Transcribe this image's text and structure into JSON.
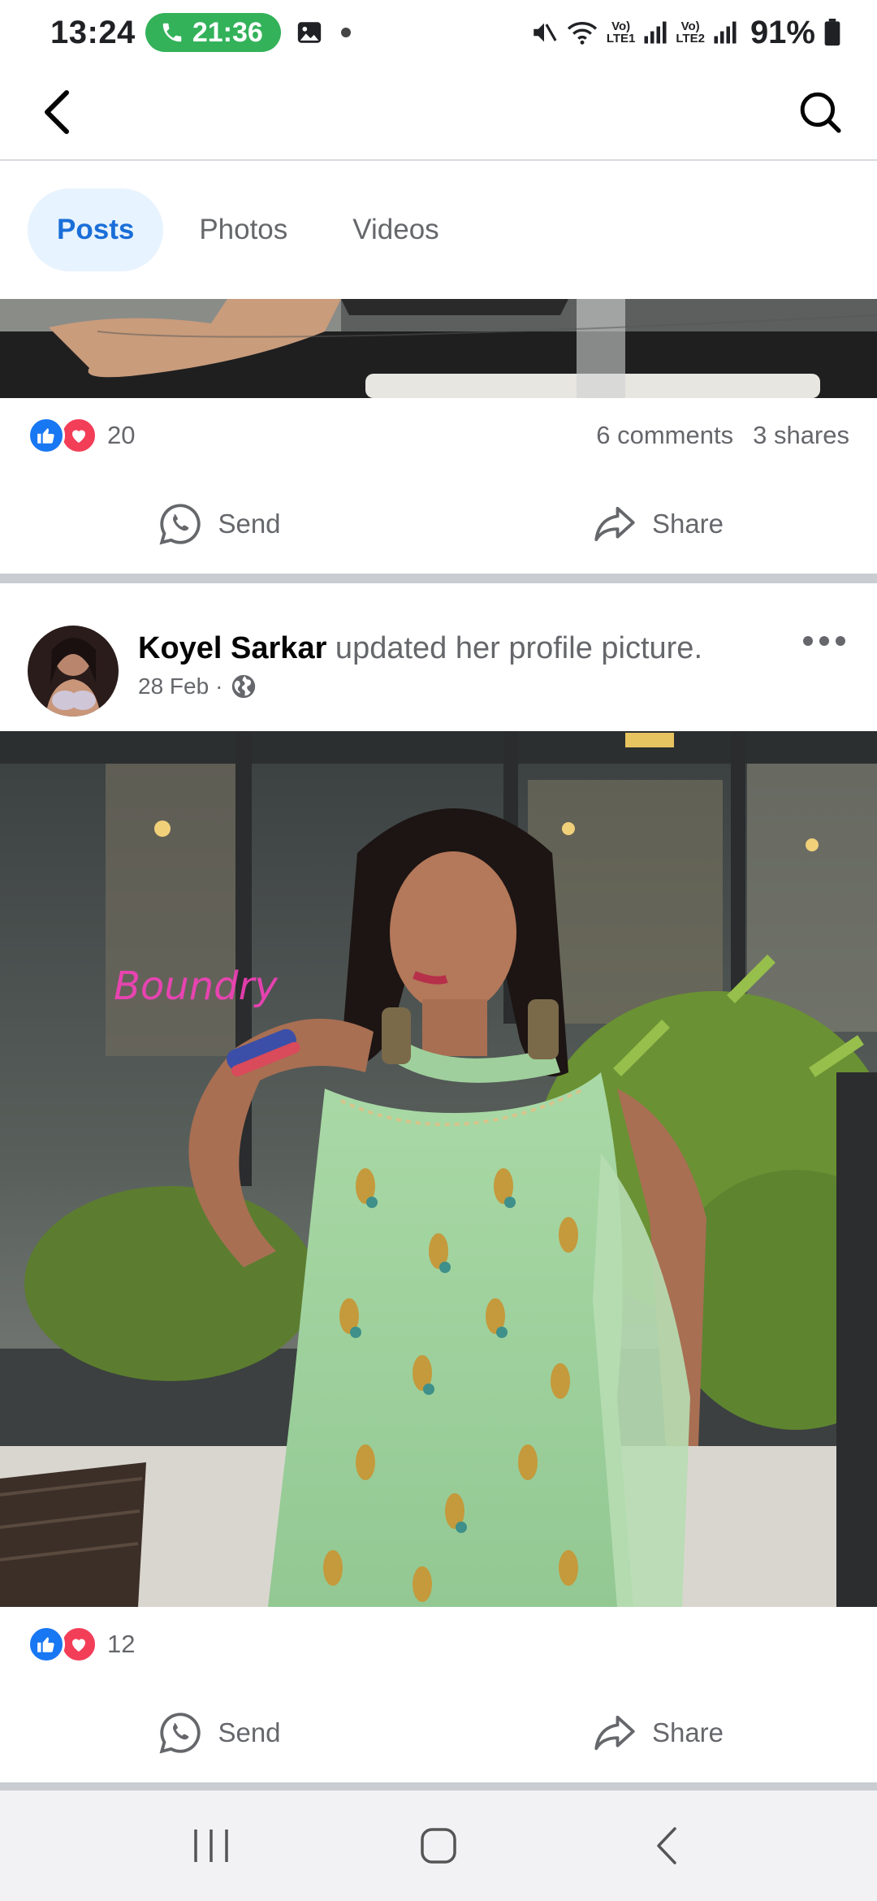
{
  "status_bar": {
    "time": "13:24",
    "call_timer": "21:36",
    "network_1": [
      "Vo)",
      "LTE1"
    ],
    "network_2": [
      "Vo)",
      "LTE2"
    ],
    "battery": "91%"
  },
  "header": {
    "back_icon": "chevron-left-icon",
    "search_icon": "search-icon"
  },
  "tabs": [
    {
      "label": "Posts",
      "active": true
    },
    {
      "label": "Photos",
      "active": false
    },
    {
      "label": "Videos",
      "active": false
    }
  ],
  "post1": {
    "reaction_count": "20",
    "comments": "6 comments",
    "shares": "3 shares",
    "send_label": "Send",
    "share_label": "Share"
  },
  "post2": {
    "author": "Koyel Sarkar",
    "action_text": " updated her profile picture.",
    "date": "28 Feb",
    "separator": "·",
    "audience_icon": "globe-icon",
    "reaction_count": "12",
    "send_label": "Send",
    "share_label": "Share"
  },
  "colors": {
    "brand_blue": "#1877f2",
    "tab_active_bg": "#e7f3ff",
    "tab_active_text": "#1a6ed8",
    "love_red": "#f33e58",
    "call_green": "#34b25a"
  }
}
